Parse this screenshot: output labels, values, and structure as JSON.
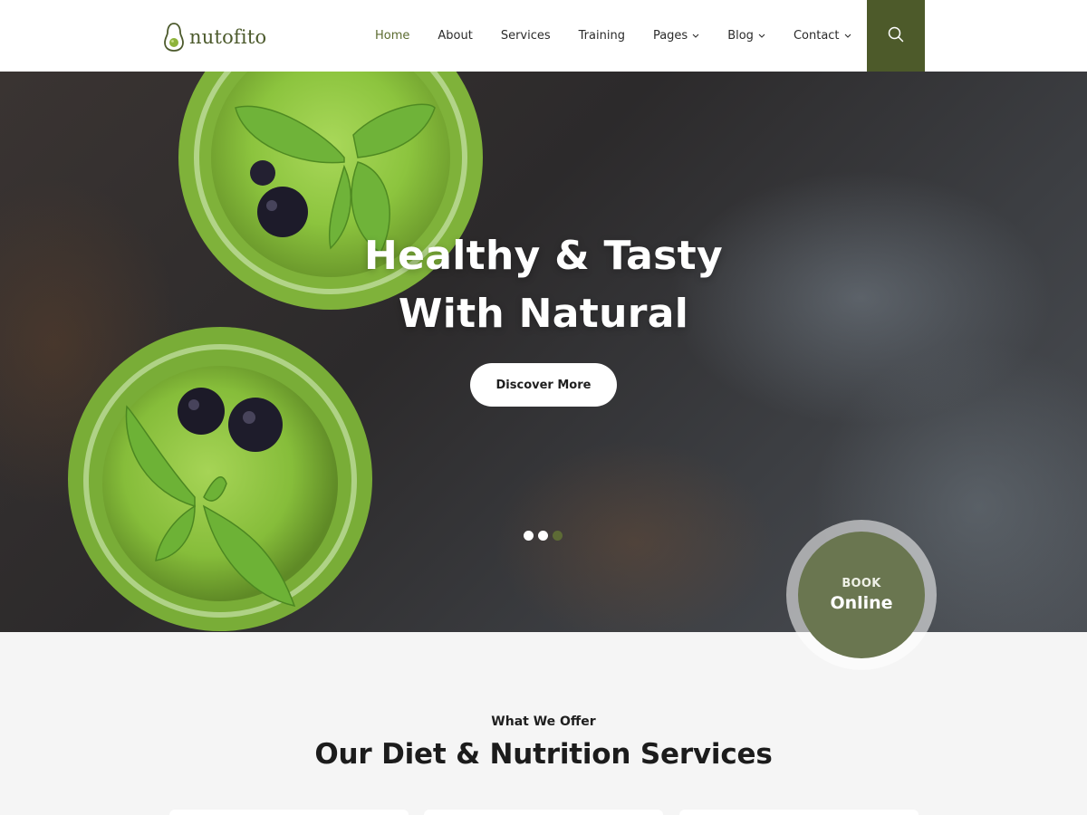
{
  "brand": {
    "name": "nutofito"
  },
  "nav": {
    "items": [
      {
        "label": "Home",
        "active": true,
        "has_dropdown": false
      },
      {
        "label": "About",
        "active": false,
        "has_dropdown": false
      },
      {
        "label": "Services",
        "active": false,
        "has_dropdown": false
      },
      {
        "label": "Training",
        "active": false,
        "has_dropdown": false
      },
      {
        "label": "Pages",
        "active": false,
        "has_dropdown": true
      },
      {
        "label": "Blog",
        "active": false,
        "has_dropdown": true
      },
      {
        "label": "Contact",
        "active": false,
        "has_dropdown": true
      }
    ],
    "search_icon": "search-icon"
  },
  "hero": {
    "title_line1": "Healthy & Tasty",
    "title_line2": "With Natural",
    "cta_label": "Discover More",
    "slides": 3,
    "current_slide": 3
  },
  "book": {
    "small": "BOOK",
    "big": "Online"
  },
  "services": {
    "tagline": "What We Offer",
    "title": "Our Diet & Nutrition Services"
  },
  "colors": {
    "accent": "#4d5a2a",
    "accent_light": "#6a7650",
    "nav_active": "#5b6b2f",
    "white": "#ffffff",
    "text_dark": "#1c1c1c"
  }
}
